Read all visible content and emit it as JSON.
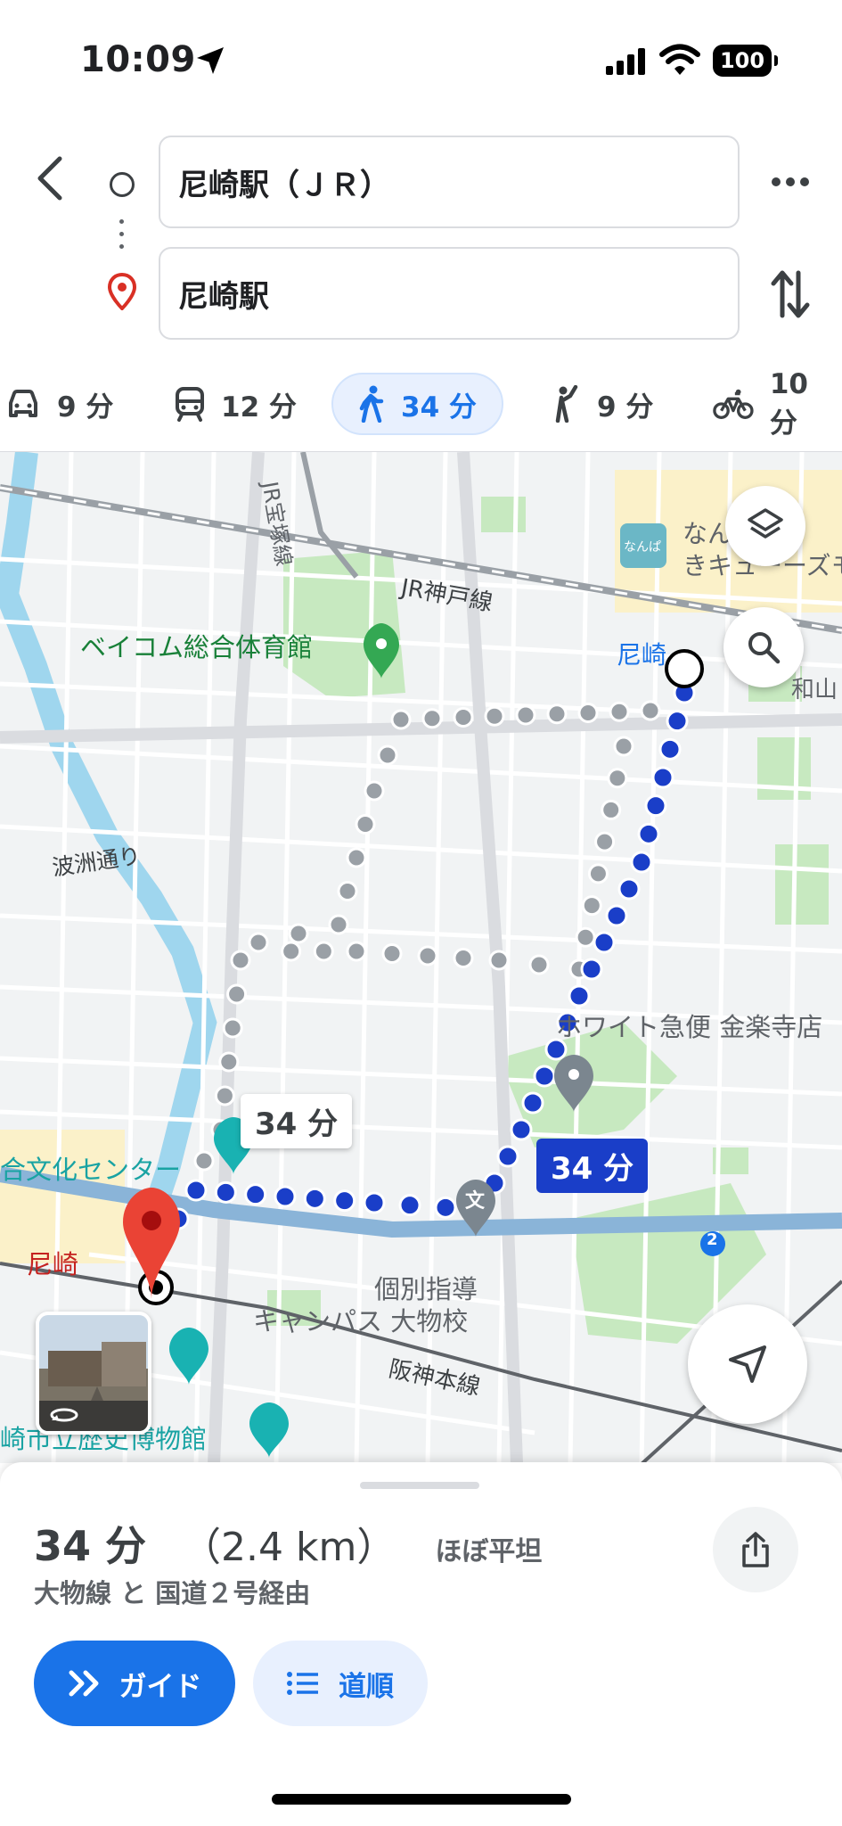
{
  "status_bar": {
    "time": "10:09",
    "battery": "100"
  },
  "header": {
    "origin": "尼崎駅（ＪＲ）",
    "destination": "尼崎駅"
  },
  "modes": [
    {
      "icon": "car-icon",
      "label": "9 分"
    },
    {
      "icon": "train-icon",
      "label": "12 分"
    },
    {
      "icon": "walk-icon",
      "label": "34 分",
      "active": true
    },
    {
      "icon": "ride-hail-icon",
      "label": "9 分"
    },
    {
      "icon": "bike-icon",
      "label": "10 分"
    }
  ],
  "map": {
    "labels": {
      "jr_takarazuka": "JR宝塚線",
      "jr_kobe": "JR神戸線",
      "gym": "ベイコム総合体育館",
      "amagasaki_jr": "尼崎",
      "nanpa": "なんぱ",
      "namba_shop": "なんばあき",
      "namba_shop2": "きキューーズモ",
      "nishiyama": "和山",
      "hadasu": "波洲通り",
      "white_kyubin": "ホワイト急便 金楽寺店",
      "bunka_center": "合文化センター",
      "amagasaki": "尼崎",
      "kobetsu1": "個別指導",
      "kobetsu2": "キャンパス 大物校",
      "hanshin": "阪神本線",
      "museum": "崎市立歴史博物館",
      "route2": "2",
      "bun": "文"
    },
    "route_time_alt": "34 分",
    "route_time_main": "34 分",
    "route_color": "#1a3ec8",
    "alt_route_color": "#9aa0a6"
  },
  "sheet": {
    "duration": "34 分",
    "distance": "（2.4 km）",
    "terrain": "ほぼ平坦",
    "via": "大物線 と 国道２号経由",
    "guide_label": "ガイド",
    "steps_label": "道順"
  }
}
